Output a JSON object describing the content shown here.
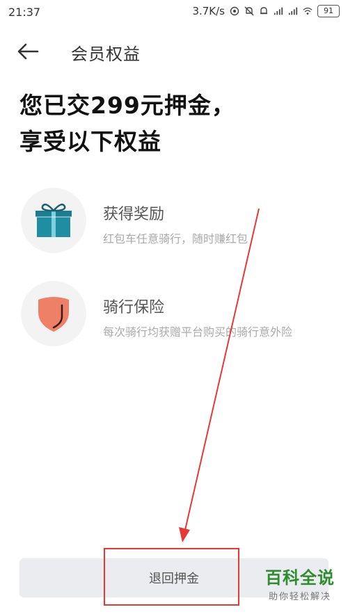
{
  "status_bar": {
    "time": "21:37",
    "speed": "3.7K/s",
    "battery": "91"
  },
  "nav": {
    "title": "会员权益"
  },
  "headline": {
    "line1": "您已交299元押金，",
    "line2": "享受以下权益"
  },
  "benefits": [
    {
      "title": "获得奖励",
      "description": "红包车任意骑行，随时赚红包",
      "icon": "gift-icon",
      "icon_color": "#1f8ea3"
    },
    {
      "title": "骑行保险",
      "description": "每次骑行均获赠平台购买的骑行意外险",
      "icon": "shield-icon",
      "icon_color": "#ef8068"
    }
  ],
  "refund_button": {
    "label": "退回押金"
  },
  "annotation": {
    "color": "#e53935"
  },
  "watermark": {
    "title": "百科全说",
    "subtitle": "助你轻松解决"
  }
}
